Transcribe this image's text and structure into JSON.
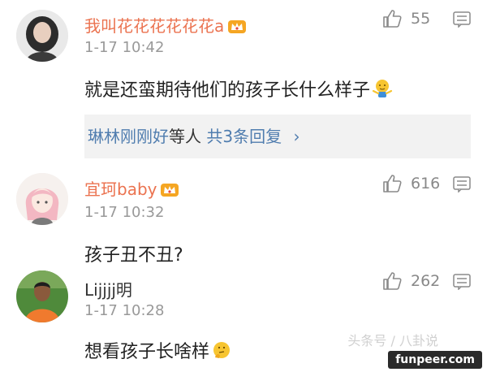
{
  "comments": [
    {
      "username": "我叫花花花花花花a",
      "timestamp": "1-17 10:42",
      "likes": "55",
      "text": "就是还蛮期待他们的孩子长什么样子",
      "replies": {
        "names": "琳林刚刚好",
        "middle": "等人",
        "count": "共3条回复",
        "arrow": "›"
      }
    },
    {
      "username": "宜珂baby",
      "timestamp": "1-17 10:32",
      "likes": "616",
      "text": "孩子丑不丑?"
    },
    {
      "username": "Lijjjj明",
      "timestamp": "1-17 10:28",
      "likes": "262",
      "text": "想看孩子长啥样"
    }
  ],
  "watermark": {
    "text": "头条号 / 八卦说",
    "site": "funpeer.com"
  },
  "colors": {
    "username": "#eb7350",
    "link": "#507daf",
    "muted": "#999999"
  }
}
